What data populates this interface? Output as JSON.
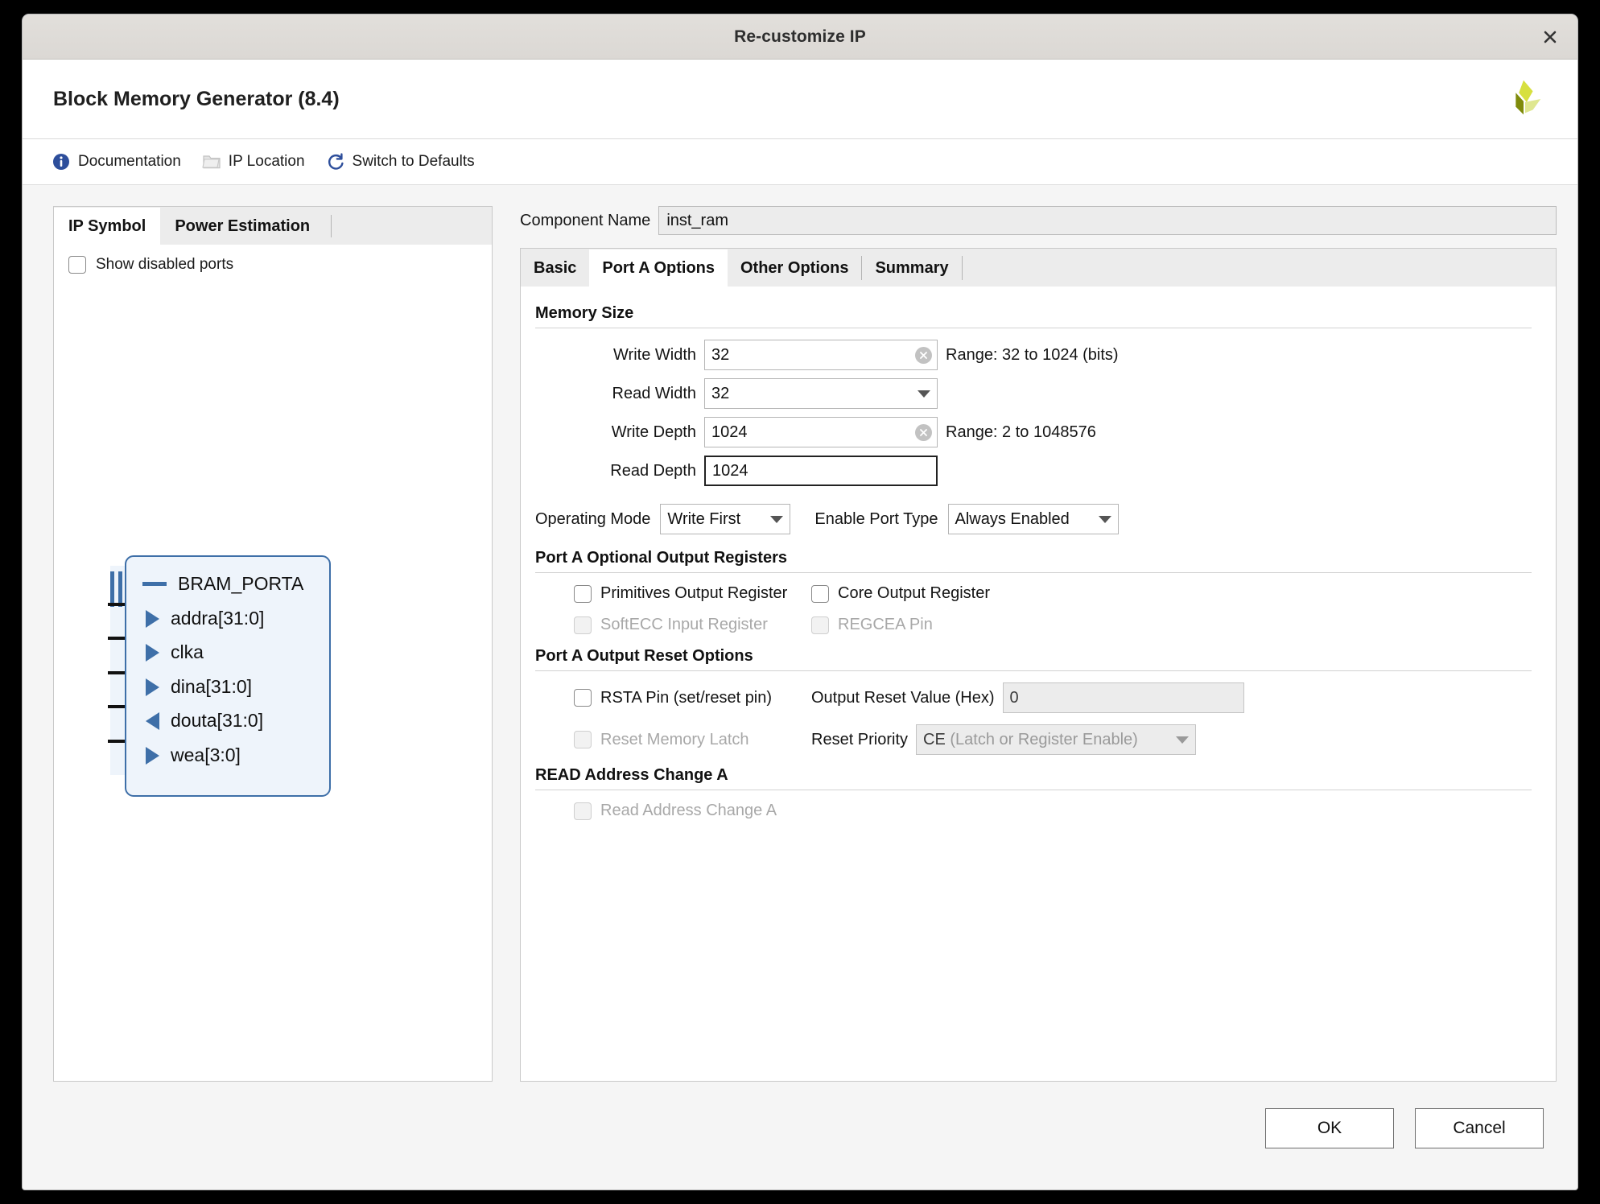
{
  "window": {
    "title": "Re-customize IP",
    "close_icon": "close-icon"
  },
  "header": {
    "product_title": "Block Memory Generator (8.4)",
    "logo_icon": "xilinx-logo-icon"
  },
  "toolbar": {
    "items": [
      {
        "label": "Documentation",
        "icon": "info-icon"
      },
      {
        "label": "IP Location",
        "icon": "folder-icon"
      },
      {
        "label": "Switch to Defaults",
        "icon": "refresh-icon"
      }
    ]
  },
  "left_panel": {
    "tabs": [
      {
        "label": "IP Symbol",
        "active": true
      },
      {
        "label": "Power Estimation",
        "active": false
      }
    ],
    "show_disabled_ports": {
      "label": "Show disabled ports",
      "checked": false
    },
    "symbol": {
      "bus_label": "BRAM_PORTA",
      "ports": [
        {
          "name": "addra[31:0]",
          "dir": "in"
        },
        {
          "name": "clka",
          "dir": "in"
        },
        {
          "name": "dina[31:0]",
          "dir": "in"
        },
        {
          "name": "douta[31:0]",
          "dir": "out"
        },
        {
          "name": "wea[3:0]",
          "dir": "in"
        }
      ]
    }
  },
  "right_panel": {
    "component_name": {
      "label": "Component Name",
      "value": "inst_ram"
    },
    "tabs": [
      {
        "label": "Basic",
        "active": false
      },
      {
        "label": "Port A Options",
        "active": true
      },
      {
        "label": "Other Options",
        "active": false
      },
      {
        "label": "Summary",
        "active": false
      }
    ],
    "memory_size": {
      "title": "Memory Size",
      "write_width": {
        "label": "Write Width",
        "value": "32",
        "range": "Range: 32 to 1024 (bits)",
        "clear_icon": "clear-field-icon"
      },
      "read_width": {
        "label": "Read Width",
        "value": "32",
        "chevron_icon": "chevron-down-icon"
      },
      "write_depth": {
        "label": "Write Depth",
        "value": "1024",
        "range": "Range: 2 to 1048576",
        "clear_icon": "clear-field-icon"
      },
      "read_depth": {
        "label": "Read Depth",
        "value": "1024"
      }
    },
    "operating": {
      "mode_label": "Operating Mode",
      "mode_value": "Write First",
      "enable_label": "Enable Port Type",
      "enable_value": "Always Enabled"
    },
    "output_registers": {
      "title": "Port A Optional Output Registers",
      "primitives": {
        "label": "Primitives Output Register",
        "checked": false,
        "disabled": false
      },
      "core": {
        "label": "Core Output Register",
        "checked": false,
        "disabled": false
      },
      "softecc": {
        "label": "SoftECC Input Register",
        "checked": false,
        "disabled": true
      },
      "regcea": {
        "label": "REGCEA Pin",
        "checked": false,
        "disabled": true
      }
    },
    "reset_options": {
      "title": "Port A Output Reset Options",
      "rsta_pin": {
        "label": "RSTA Pin (set/reset pin)",
        "checked": false,
        "disabled": false
      },
      "reset_value": {
        "label": "Output Reset Value (Hex)",
        "value": "0",
        "disabled": true
      },
      "reset_memory_latch": {
        "label": "Reset Memory Latch",
        "checked": false,
        "disabled": true
      },
      "reset_priority": {
        "label": "Reset Priority",
        "value_strong": "CE",
        "value_rest": " (Latch or Register Enable)",
        "disabled": true
      }
    },
    "read_address_change": {
      "title": "READ Address Change A",
      "checkbox": {
        "label": "Read Address Change A",
        "checked": false,
        "disabled": true
      }
    }
  },
  "footer": {
    "ok_label": "OK",
    "cancel_label": "Cancel"
  },
  "colors": {
    "accent_blue": "#3e6fa8",
    "symbol_fill": "#eef4fb",
    "logo_green": "#c9d630",
    "logo_olive": "#7f8b0b",
    "info_blue": "#2d4e9b"
  }
}
